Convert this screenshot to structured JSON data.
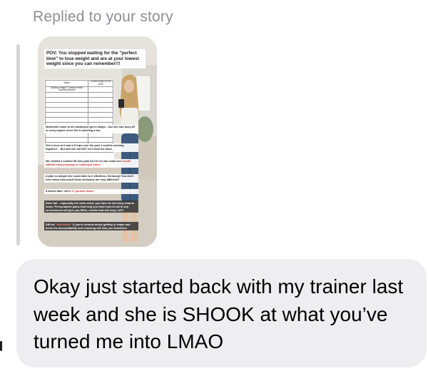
{
  "header": {
    "reply_label": "Replied to your story"
  },
  "story": {
    "caption": "POV: You stopped waiting for the \"perfect time\" to lose weight and are at your lowest weight since you can remember!!!",
    "tracker_headers": [
      "Week",
      "Lowest weight of the week"
    ],
    "tracker_rows": [
      [
        "Starting Weight: 3 weeks before coaching started",
        ""
      ],
      [
        "",
        ""
      ],
      [
        "",
        ""
      ],
      [
        "",
        ""
      ],
      [
        "",
        ""
      ],
      [
        "",
        ""
      ],
      [
        "",
        ""
      ],
      [
        "",
        ""
      ],
      [
        "",
        ""
      ],
      [
        "",
        ""
      ],
      [
        "",
        ""
      ],
      [
        "",
        ""
      ],
      [
        "",
        ""
      ]
    ],
    "notes": [
      {
        "text": "Workshire came to me wanting to get in shape... but she was busy AF in every aspect of her life & traveling a ton.",
        "style": "light"
      },
      {
        "text": "She's been at it and 4-5 trips over the past 2 months working together!... But still she did NOT let it hold her back.",
        "style": "light"
      },
      {
        "text": "We created a custom fat loss plan for her so she could see results without meal prepping or cooking at home.",
        "style": "light",
        "highlight": "results without meal prepping or cooking at home."
      },
      {
        "text": "A plan so simple she could stick to it effortless. Seriously! You don't even know how much these decisions are very different!!",
        "style": "light"
      },
      {
        "text": "8 weeks later: she's 17 pounds down!",
        "style": "light",
        "highlight": "17 pounds down!"
      },
      {
        "text": "Diets fail... especially the ones where you have to eat every meal at home. Personalized plans that help you learn how to eat in any environment will give you REAL results that will truly LAST.",
        "style": "dark"
      },
      {
        "text": "DM me \"alternative\" if you're serious about getting in shape and know the accountability and coaching will help you transform",
        "style": "dark",
        "highlight": "\"alternative\""
      }
    ]
  },
  "message": {
    "text": "Okay just started back with my trainer last week and she is SHOOK at what you’ve turned me into LMAO"
  },
  "colors": {
    "header_text": "#8e8e93",
    "bubble_background": "#eeeef0",
    "reply_bar": "#d6d6d9",
    "highlight": "#d0312d"
  }
}
